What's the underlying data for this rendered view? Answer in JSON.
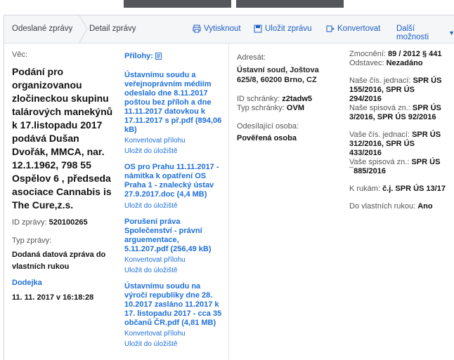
{
  "breadcrumb": {
    "item1": "Odeslané zprávy",
    "item2": "Detail zprávy"
  },
  "toolbar": {
    "print": "Vytisknout",
    "save": "Uložit zprávu",
    "convert": "Konvertovat",
    "more": "Další možnosti"
  },
  "left": {
    "subject_label": "Věc:",
    "subject": "Podání pro organizovanou zločineckou skupinu talárových manekýnů k 17.listopadu 2017 podává Dušan Dvořák, MMCA, nar. 12.1.1962, 798 55 Ospělov 6 , předseda asociace Cannabis is The Cure,z.s.",
    "id_label": "ID zprávy:",
    "id_value": "520100265",
    "type_label": "Typ zprávy:",
    "type_value": "Dodaná datová zpráva do vlastních rukou",
    "delivery_label": "Dodejka",
    "delivery_time": "11. 11. 2017 v 16:18:28"
  },
  "attachments": {
    "label": "Přílohy:",
    "items": [
      {
        "name": "Ústavnímu soudu a veřejnoprávním médiím odeslalo dne 8.11.2017 poštou bez příloh a dne 11.11.2017 datovkou k 17.11.2017 s př.pdf (894,06 kB)",
        "convert": "Konvertovat přílohu",
        "save": "Uložit do úložiště"
      },
      {
        "name": "OS pro Prahu 11.11.2017 - námitka k opatření OS Praha 1 - znalecký ústav 27.9.2017.doc (4,4 MB)",
        "save": "Uložit do úložiště"
      },
      {
        "name": "Porušení práva Společenství - právní arguementace, 5.11.207.pdf (256,49 kB)",
        "convert": "Konvertovat přílohu",
        "save": "Uložit do úložiště"
      },
      {
        "name": "Ústavnímu soudu na výročí republiky dne 28. 10.2017 zasláno 11.2017 k 17. listopadu 2017 - cca 35 občanů ČR.pdf (4,81 MB)",
        "convert": "Konvertovat přílohu",
        "save": "Uložit do úložiště"
      }
    ]
  },
  "recipient": {
    "address_label": "Adresát:",
    "address": "Ústavní soud, Joštova 625/8, 60200 Brno, CZ",
    "box_label": "ID schránky:",
    "box_value": "z2tadw5",
    "box_type_label": "Typ schránky:",
    "box_type_value": "OVM",
    "sender_label": "Odesílající osoba:",
    "sender_value": "Pověřená osoba"
  },
  "meta": {
    "auth_label": "Zmocnění:",
    "auth_value": "89 / 2012 § 441",
    "sent_label": "Odstavec:",
    "sent_value": "Nezadáno",
    "our_ref_label": "Naše čís. jednací:",
    "our_ref_value": "SPR ÚS 155/2016, SPR ÚS 294/2016",
    "our_file_label": "Naše spisová zn.:",
    "our_file_value": "SPR ÚS 3/2016, SPR ÚS 92/2016",
    "your_ref_label": "Vaše čís. jednací:",
    "your_ref_value": "SPR ÚS 312/2016, SPR ÚS 433/2016",
    "your_file_label": "Vaše spisová zn.:",
    "your_file_value": "SPR ÚS ¯885/2016",
    "hands_label": "K rukám:",
    "hands_value": "č.j. SPR ÚS 13/17",
    "own_label": "Do vlastních rukou:",
    "own_value": "Ano"
  }
}
